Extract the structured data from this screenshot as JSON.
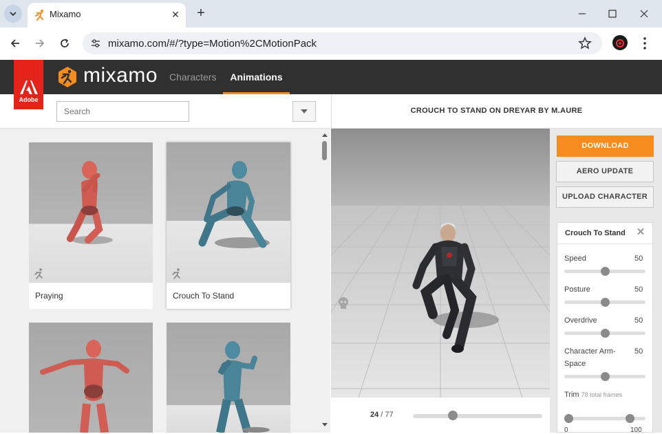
{
  "browser": {
    "tab_title": "Mixamo",
    "url": "mixamo.com/#/?type=Motion%2CMotionPack"
  },
  "header": {
    "adobe_label": "Adobe",
    "logo_text": "mixamo",
    "nav": {
      "characters": "Characters",
      "animations": "Animations"
    }
  },
  "search": {
    "placeholder": "Search"
  },
  "cards": [
    {
      "label": "Praying"
    },
    {
      "label": "Crouch To Stand"
    },
    {
      "label": ""
    },
    {
      "label": ""
    }
  ],
  "preview": {
    "title": "CROUCH TO STAND ON DREYAR BY M.AURE",
    "frame_current": "24",
    "frame_separator": " / ",
    "frame_total": "77",
    "timeline_progress": 0.31
  },
  "actions": {
    "download": "DOWNLOAD",
    "aero_update": "AERO UPDATE",
    "upload_character": "UPLOAD CHARACTER"
  },
  "settings": {
    "title": "Crouch To Stand",
    "params": [
      {
        "label": "Speed",
        "value": "50",
        "level": 0.5
      },
      {
        "label": "Posture",
        "value": "50",
        "level": 0.5
      },
      {
        "label": "Overdrive",
        "value": "50",
        "level": 0.5
      },
      {
        "label": "Character Arm-Space",
        "value": "50",
        "level": 0.5
      }
    ],
    "trim": {
      "label": "Trim",
      "sub": "78 total frames",
      "start": "0",
      "end": "100"
    }
  },
  "colors": {
    "accent": "#f68c1f",
    "header_bg": "#303030",
    "adobe_red": "#e4231b"
  }
}
